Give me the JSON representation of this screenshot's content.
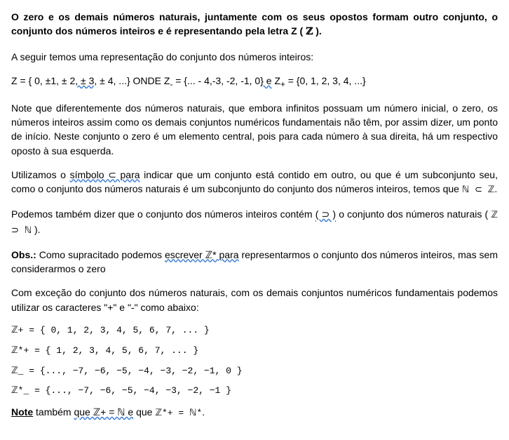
{
  "p1_a": "O zero e os demais números naturais, juntamente com os seus opostos formam outro conjunto, o conjunto dos números inteiros e é representando pela letra Z ( ",
  "p1_z": "ℤ",
  "p1_b": " ).",
  "p2": "A seguir temos uma representação do conjunto dos números inteiros:",
  "p3_a": "Z = { 0, ±1, ± 2",
  "p3_s1": ", ± 3,",
  "p3_b": " ± 4, ...}   ONDE   Z",
  "p3_sub1": "-",
  "p3_c": " = {... - 4,-3, -2, -1, 0",
  "p3_s2": "}  e",
  "p3_d": "  Z",
  "p3_sub2": "+",
  "p3_e": " = {0, 1, 2, 3, 4, ...}",
  "p4": "Note que diferentemente dos números naturais, que embora infinitos possuam um número inicial, o zero, os números inteiros assim como os demais conjuntos numéricos fundamentais não têm, por assim dizer, um ponto de início. Neste conjunto o zero é um elemento central, pois para cada número à sua direita, há um respectivo oposto à sua esquerda.",
  "p5_a": "Utilizamos o ",
  "p5_s1": "símbolo  ⊂  para",
  "p5_b": " indicar que um conjunto está contido em outro, ou que é um subconjunto seu, como o conjunto dos números naturais é um subconjunto do conjunto dos números inteiros, temos que  ",
  "p5_c": "ℕ  ⊂  ℤ",
  "p5_d": ".",
  "p6_a": "Podemos também dizer que o conjunto dos números inteiros contém ",
  "p6_s1": "( ⊃ )",
  "p6_b": " o conjunto dos números naturais  (  ",
  "p6_c": "ℤ  ⊃  ℕ",
  "p6_d": " ).",
  "p7_label": "Obs.:",
  "p7_a": " Como supracitado podemos ",
  "p7_s1": "escrever  ℤ*  para",
  "p7_b": " representarmos o conjunto dos números inteiros, mas sem considerarmos o zero",
  "p8": "Com exceção do conjunto dos números naturais, com os demais conjuntos numéricos fundamentais podemos utilizar os caracteres \"+\" e \"-\" como abaixo:",
  "eq1": "ℤ+  =  { 0, 1, 2, 3, 4, 5, 6, 7, ... }",
  "eq2": "ℤ*+  =  { 1, 2, 3, 4, 5, 6, 7, ... }",
  "eq3": "ℤ_  =  {..., −7, −6, −5, −4, −3, −2, −1, 0 }",
  "eq4": "ℤ*_  =  {..., −7, −6, −5, −4, −3, −2, −1 }",
  "p9_label": "Note",
  "p9_a": " também ",
  "p9_s1": "que  ℤ+  =  ℕ e",
  "p9_b": " que  ",
  "p9_c": "ℤ*+  =  ℕ*",
  "p9_d": "."
}
